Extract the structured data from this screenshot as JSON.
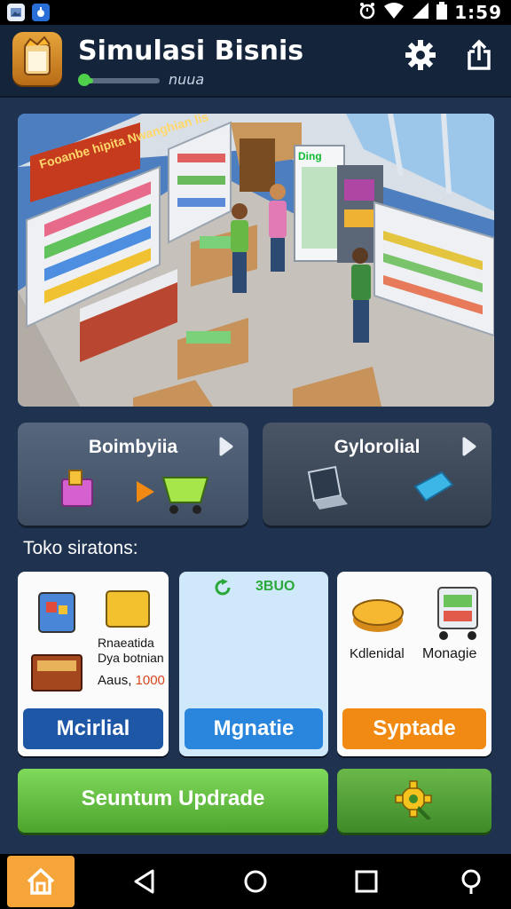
{
  "status_bar": {
    "time": "1:59"
  },
  "header": {
    "title": "Simulasi Bisnis",
    "progress_label": "nuua",
    "progress_fraction": 0.15,
    "settings_icon": "gear-icon",
    "share_icon": "share-icon"
  },
  "hero": {
    "store_sign": "Fooanbe hipita Nwanghian lis",
    "fridge_label": "Ding"
  },
  "nav_cards": [
    {
      "label": "Boimbyiia",
      "icon": "basket-to-cart-icon"
    },
    {
      "label": "Gylorolial",
      "icon": "laptop-tag-icon"
    }
  ],
  "section_title": "Toko siratons:",
  "cards": [
    {
      "lines": [
        "Rnaeatida",
        "Dya botnian"
      ],
      "price_prefix": "Aaus,",
      "price_value": "1000",
      "button": "Mcirlial",
      "button_color": "#1e57a6"
    },
    {
      "tag": "3BUO",
      "button": "Mgnatie",
      "button_color": "#2a86dd"
    },
    {
      "labels": [
        "Kdlenidal",
        "Monagie"
      ],
      "button": "Syptade",
      "button_color": "#f08a12"
    }
  ],
  "actions": {
    "primary": "Seuntum Updrade",
    "secondary_icon": "gear-icon"
  },
  "colors": {
    "background": "#1f3350",
    "green_action": "#5cc23a",
    "orange": "#f08a12",
    "blue": "#1e57a6"
  }
}
